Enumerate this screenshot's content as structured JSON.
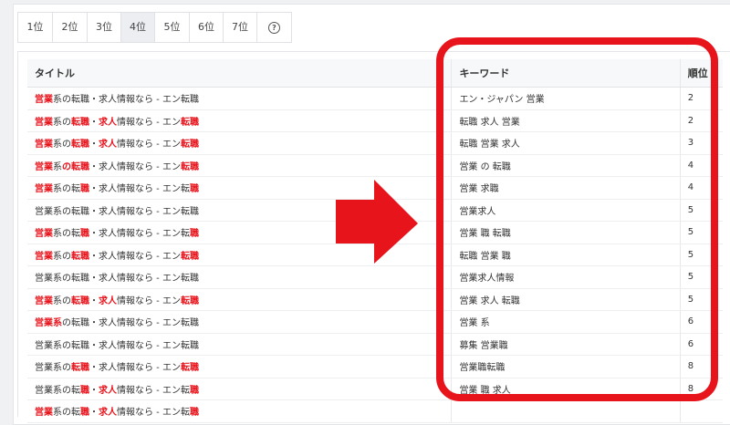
{
  "tabs": [
    {
      "label": "1位",
      "width": 38
    },
    {
      "label": "2位",
      "width": 38
    },
    {
      "label": "3位",
      "width": 37
    },
    {
      "label": "4位",
      "width": 37,
      "active": true
    },
    {
      "label": "5位",
      "width": 38
    },
    {
      "label": "6位",
      "width": 37
    },
    {
      "label": "7位",
      "width": 37
    },
    {
      "label": "",
      "width": 37,
      "icon": "help-icon"
    }
  ],
  "table": {
    "headers": {
      "title": "タイトル",
      "keyword": "キーワード",
      "rank": "順位"
    },
    "rows": [
      {
        "title": [
          [
            "営業",
            "hl"
          ],
          [
            "系の転職・求人情報なら - エン転職",
            ""
          ]
        ],
        "keyword": "エン・ジャパン 営業",
        "rank": "2"
      },
      {
        "title": [
          [
            "営業",
            "hl"
          ],
          [
            "系の",
            ""
          ],
          [
            "転職",
            "hl"
          ],
          [
            "・",
            ""
          ],
          [
            "求人",
            "hl"
          ],
          [
            "情報なら - エン",
            ""
          ],
          [
            "転職",
            "hl"
          ]
        ],
        "keyword": "転職 求人 営業",
        "rank": "2"
      },
      {
        "title": [
          [
            "営業",
            "hl"
          ],
          [
            "系の",
            ""
          ],
          [
            "転職",
            "hl"
          ],
          [
            "・",
            ""
          ],
          [
            "求人",
            "hl"
          ],
          [
            "情報なら - エン",
            ""
          ],
          [
            "転職",
            "hl"
          ]
        ],
        "keyword": "転職 営業 求人",
        "rank": "3"
      },
      {
        "title": [
          [
            "営業",
            "hl"
          ],
          [
            "系",
            ""
          ],
          [
            "の",
            "hl"
          ],
          [
            "転職",
            "hl"
          ],
          [
            "・求人情報なら - エン",
            ""
          ],
          [
            "転職",
            "hl"
          ]
        ],
        "keyword": "営業 の 転職",
        "rank": "4"
      },
      {
        "title": [
          [
            "営業",
            "hl"
          ],
          [
            "系の転",
            ""
          ],
          [
            "職",
            "hl"
          ],
          [
            "・求人情報なら - エン転",
            ""
          ],
          [
            "職",
            "hl"
          ]
        ],
        "keyword": "営業 求職",
        "rank": "4"
      },
      {
        "title": [
          [
            "営業系の転職・求人情報なら - エン転職",
            ""
          ]
        ],
        "keyword": "営業求人",
        "rank": "5"
      },
      {
        "title": [
          [
            "営業",
            "hl"
          ],
          [
            "系の転",
            ""
          ],
          [
            "職",
            "hl"
          ],
          [
            "・求人情報なら - エン転",
            ""
          ],
          [
            "職",
            "hl"
          ]
        ],
        "keyword": "営業 職 転職",
        "rank": "5"
      },
      {
        "title": [
          [
            "営業",
            "hl"
          ],
          [
            "系の",
            ""
          ],
          [
            "転職",
            "hl"
          ],
          [
            "・求人情報なら - エン",
            ""
          ],
          [
            "転職",
            "hl"
          ]
        ],
        "keyword": "転職 営業 職",
        "rank": "5"
      },
      {
        "title": [
          [
            "営業系の転職・求人情報なら - エン転職",
            ""
          ]
        ],
        "keyword": "営業求人情報",
        "rank": "5"
      },
      {
        "title": [
          [
            "営業",
            "hl"
          ],
          [
            "系の",
            ""
          ],
          [
            "転職",
            "hl"
          ],
          [
            "・",
            ""
          ],
          [
            "求人",
            "hl"
          ],
          [
            "情報なら - エン",
            ""
          ],
          [
            "転職",
            "hl"
          ]
        ],
        "keyword": "営業 求人 転職",
        "rank": "5"
      },
      {
        "title": [
          [
            "営業系",
            "hl"
          ],
          [
            "の転職・求人情報なら - エン転職",
            ""
          ]
        ],
        "keyword": "営業 系",
        "rank": "6"
      },
      {
        "title": [
          [
            "営業系の転職・求人情報なら - エン転職",
            ""
          ]
        ],
        "keyword": "募集 営業職",
        "rank": "6"
      },
      {
        "title": [
          [
            "営業系の",
            ""
          ],
          [
            "転職",
            "hl"
          ],
          [
            "・求人情報なら - エン",
            ""
          ],
          [
            "転職",
            "hl"
          ]
        ],
        "keyword": "営業職転職",
        "rank": "8"
      },
      {
        "title": [
          [
            "営業系の転",
            ""
          ],
          [
            "職",
            "hl"
          ],
          [
            "・",
            ""
          ],
          [
            "求人",
            "hl"
          ],
          [
            "情報なら - エン転",
            ""
          ],
          [
            "職",
            "hl"
          ]
        ],
        "keyword": "営業 職 求人",
        "rank": "8"
      },
      {
        "title": [
          [
            "営業",
            "hl"
          ],
          [
            "系の転",
            ""
          ],
          [
            "職",
            "hl"
          ],
          [
            "・",
            ""
          ],
          [
            "求人",
            "hl"
          ],
          [
            "情報なら - エン転",
            ""
          ],
          [
            "職",
            "hl"
          ]
        ],
        "keyword": "",
        "rank": ""
      }
    ]
  },
  "colors": {
    "highlight": "#e8141c",
    "frame": "#e8141c",
    "arrow": "#e8141c"
  }
}
